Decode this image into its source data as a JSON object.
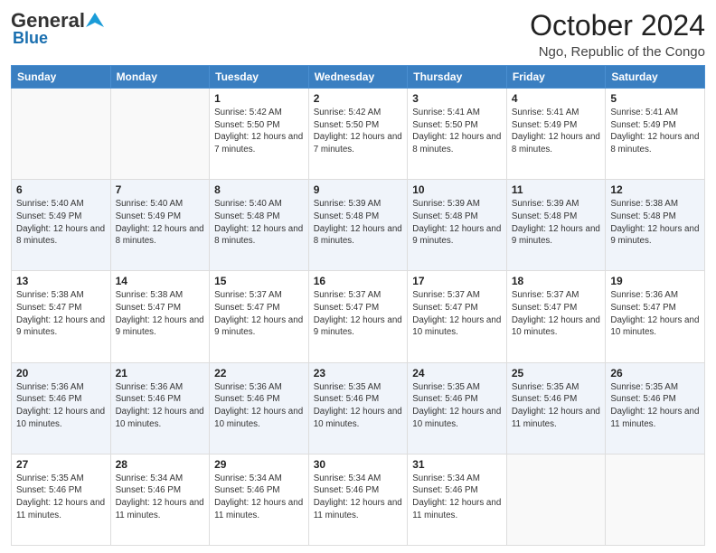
{
  "logo": {
    "general": "General",
    "blue": "Blue"
  },
  "header": {
    "month": "October 2024",
    "location": "Ngo, Republic of the Congo"
  },
  "days_of_week": [
    "Sunday",
    "Monday",
    "Tuesday",
    "Wednesday",
    "Thursday",
    "Friday",
    "Saturday"
  ],
  "weeks": [
    [
      {
        "day": "",
        "info": ""
      },
      {
        "day": "",
        "info": ""
      },
      {
        "day": "1",
        "info": "Sunrise: 5:42 AM\nSunset: 5:50 PM\nDaylight: 12 hours and 7 minutes."
      },
      {
        "day": "2",
        "info": "Sunrise: 5:42 AM\nSunset: 5:50 PM\nDaylight: 12 hours and 7 minutes."
      },
      {
        "day": "3",
        "info": "Sunrise: 5:41 AM\nSunset: 5:50 PM\nDaylight: 12 hours and 8 minutes."
      },
      {
        "day": "4",
        "info": "Sunrise: 5:41 AM\nSunset: 5:49 PM\nDaylight: 12 hours and 8 minutes."
      },
      {
        "day": "5",
        "info": "Sunrise: 5:41 AM\nSunset: 5:49 PM\nDaylight: 12 hours and 8 minutes."
      }
    ],
    [
      {
        "day": "6",
        "info": "Sunrise: 5:40 AM\nSunset: 5:49 PM\nDaylight: 12 hours and 8 minutes."
      },
      {
        "day": "7",
        "info": "Sunrise: 5:40 AM\nSunset: 5:49 PM\nDaylight: 12 hours and 8 minutes."
      },
      {
        "day": "8",
        "info": "Sunrise: 5:40 AM\nSunset: 5:48 PM\nDaylight: 12 hours and 8 minutes."
      },
      {
        "day": "9",
        "info": "Sunrise: 5:39 AM\nSunset: 5:48 PM\nDaylight: 12 hours and 8 minutes."
      },
      {
        "day": "10",
        "info": "Sunrise: 5:39 AM\nSunset: 5:48 PM\nDaylight: 12 hours and 9 minutes."
      },
      {
        "day": "11",
        "info": "Sunrise: 5:39 AM\nSunset: 5:48 PM\nDaylight: 12 hours and 9 minutes."
      },
      {
        "day": "12",
        "info": "Sunrise: 5:38 AM\nSunset: 5:48 PM\nDaylight: 12 hours and 9 minutes."
      }
    ],
    [
      {
        "day": "13",
        "info": "Sunrise: 5:38 AM\nSunset: 5:47 PM\nDaylight: 12 hours and 9 minutes."
      },
      {
        "day": "14",
        "info": "Sunrise: 5:38 AM\nSunset: 5:47 PM\nDaylight: 12 hours and 9 minutes."
      },
      {
        "day": "15",
        "info": "Sunrise: 5:37 AM\nSunset: 5:47 PM\nDaylight: 12 hours and 9 minutes."
      },
      {
        "day": "16",
        "info": "Sunrise: 5:37 AM\nSunset: 5:47 PM\nDaylight: 12 hours and 9 minutes."
      },
      {
        "day": "17",
        "info": "Sunrise: 5:37 AM\nSunset: 5:47 PM\nDaylight: 12 hours and 10 minutes."
      },
      {
        "day": "18",
        "info": "Sunrise: 5:37 AM\nSunset: 5:47 PM\nDaylight: 12 hours and 10 minutes."
      },
      {
        "day": "19",
        "info": "Sunrise: 5:36 AM\nSunset: 5:47 PM\nDaylight: 12 hours and 10 minutes."
      }
    ],
    [
      {
        "day": "20",
        "info": "Sunrise: 5:36 AM\nSunset: 5:46 PM\nDaylight: 12 hours and 10 minutes."
      },
      {
        "day": "21",
        "info": "Sunrise: 5:36 AM\nSunset: 5:46 PM\nDaylight: 12 hours and 10 minutes."
      },
      {
        "day": "22",
        "info": "Sunrise: 5:36 AM\nSunset: 5:46 PM\nDaylight: 12 hours and 10 minutes."
      },
      {
        "day": "23",
        "info": "Sunrise: 5:35 AM\nSunset: 5:46 PM\nDaylight: 12 hours and 10 minutes."
      },
      {
        "day": "24",
        "info": "Sunrise: 5:35 AM\nSunset: 5:46 PM\nDaylight: 12 hours and 10 minutes."
      },
      {
        "day": "25",
        "info": "Sunrise: 5:35 AM\nSunset: 5:46 PM\nDaylight: 12 hours and 11 minutes."
      },
      {
        "day": "26",
        "info": "Sunrise: 5:35 AM\nSunset: 5:46 PM\nDaylight: 12 hours and 11 minutes."
      }
    ],
    [
      {
        "day": "27",
        "info": "Sunrise: 5:35 AM\nSunset: 5:46 PM\nDaylight: 12 hours and 11 minutes."
      },
      {
        "day": "28",
        "info": "Sunrise: 5:34 AM\nSunset: 5:46 PM\nDaylight: 12 hours and 11 minutes."
      },
      {
        "day": "29",
        "info": "Sunrise: 5:34 AM\nSunset: 5:46 PM\nDaylight: 12 hours and 11 minutes."
      },
      {
        "day": "30",
        "info": "Sunrise: 5:34 AM\nSunset: 5:46 PM\nDaylight: 12 hours and 11 minutes."
      },
      {
        "day": "31",
        "info": "Sunrise: 5:34 AM\nSunset: 5:46 PM\nDaylight: 12 hours and 11 minutes."
      },
      {
        "day": "",
        "info": ""
      },
      {
        "day": "",
        "info": ""
      }
    ]
  ]
}
